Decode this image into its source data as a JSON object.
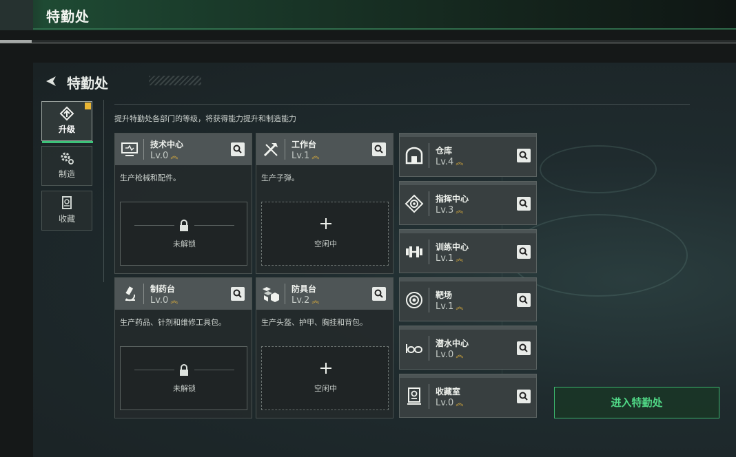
{
  "header": {
    "title": "特勤处"
  },
  "panel": {
    "title": "特勤处",
    "description": "提升特勤处各部门的等级，将获得能力提升和制造能力"
  },
  "sidebar": {
    "items": [
      {
        "label": "升级",
        "icon": "upgrade-icon",
        "active": true,
        "badge": true
      },
      {
        "label": "制造",
        "icon": "gear-icon",
        "active": false
      },
      {
        "label": "收藏",
        "icon": "collection-icon",
        "active": false
      }
    ]
  },
  "cards": [
    {
      "name": "技术中心",
      "level": "Lv.0",
      "icon": "tech-center-icon",
      "desc": "生产枪械和配件。",
      "slot": "未解锁",
      "locked": true
    },
    {
      "name": "工作台",
      "level": "Lv.1",
      "icon": "workbench-icon",
      "desc": "生产子弹。",
      "slot": "空闲中",
      "locked": false
    },
    {
      "name": "制药台",
      "level": "Lv.0",
      "icon": "pharmacy-icon",
      "desc": "生产药品、针剂和维修工具包。",
      "slot": "未解锁",
      "locked": true
    },
    {
      "name": "防具台",
      "level": "Lv.2",
      "icon": "armor-icon",
      "desc": "生产头盔、护甲、胸挂和背包。",
      "slot": "空闲中",
      "locked": false
    }
  ],
  "facilities": [
    {
      "name": "仓库",
      "level": "Lv.4",
      "icon": "warehouse-icon"
    },
    {
      "name": "指挥中心",
      "level": "Lv.3",
      "icon": "command-center-icon"
    },
    {
      "name": "训练中心",
      "level": "Lv.1",
      "icon": "dumbbell-icon"
    },
    {
      "name": "靶场",
      "level": "Lv.1",
      "icon": "target-icon"
    },
    {
      "name": "潜水中心",
      "level": "Lv.0",
      "icon": "diving-goggles-icon"
    },
    {
      "name": "收藏室",
      "level": "Lv.0",
      "icon": "collection-room-icon"
    }
  ],
  "enter_button": "进入特勤处",
  "colors": {
    "accent": "#3ec27a",
    "level_chevron": "#e3b23a",
    "badge": "#e9b533"
  }
}
